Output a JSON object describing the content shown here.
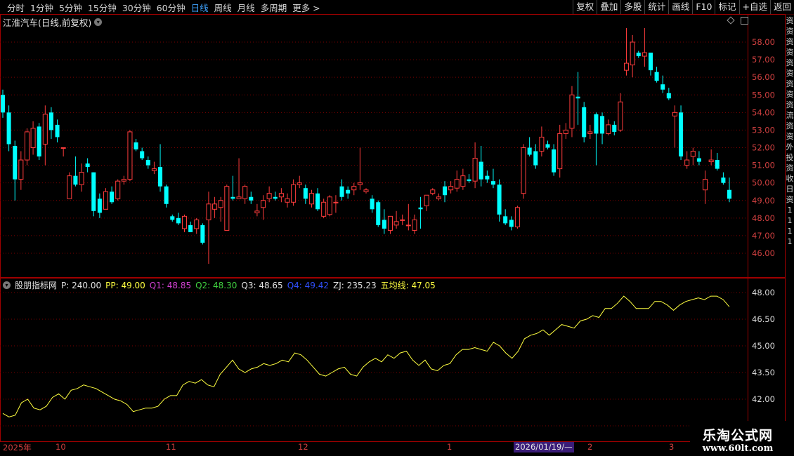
{
  "toolbar": {
    "left": [
      {
        "label": "分时",
        "active": false
      },
      {
        "label": "1分钟",
        "active": false
      },
      {
        "label": "5分钟",
        "active": false
      },
      {
        "label": "15分钟",
        "active": false
      },
      {
        "label": "30分钟",
        "active": false
      },
      {
        "label": "60分钟",
        "active": false
      },
      {
        "label": "日线",
        "active": true
      },
      {
        "label": "周线",
        "active": false
      },
      {
        "label": "月线",
        "active": false
      },
      {
        "label": "多周期",
        "active": false
      },
      {
        "label": "更多 >",
        "active": false
      }
    ],
    "right": [
      "复权",
      "叠加",
      "多股",
      "统计",
      "画线",
      "F10",
      "标记",
      "+自选",
      "返回"
    ]
  },
  "stock": {
    "title": "江淮汽车(日线,前复权)"
  },
  "indicator": {
    "name": "股朋指标网",
    "items": [
      {
        "label": "P: 240.00",
        "color": "#e0e0e0"
      },
      {
        "label": "PP: 49.00",
        "color": "#ffff40"
      },
      {
        "label": "Q1: 48.85",
        "color": "#d040d0"
      },
      {
        "label": "Q2: 48.30",
        "color": "#40d040"
      },
      {
        "label": "Q3: 48.65",
        "color": "#e0e0e0"
      },
      {
        "label": "Q4: 49.42",
        "color": "#3050ff"
      },
      {
        "label": "ZJ: 235.23",
        "color": "#e0e0e0"
      },
      {
        "label": "五均线: 47.05",
        "color": "#ffff40"
      }
    ]
  },
  "price_axis": [
    "58.00",
    "57.00",
    "56.00",
    "55.00",
    "54.00",
    "53.00",
    "52.00",
    "51.00",
    "50.00",
    "49.00",
    "48.00",
    "47.00",
    "46.00"
  ],
  "indicator_axis": [
    "48.00",
    "46.50",
    "45.00",
    "43.50",
    "42.00"
  ],
  "date_axis": [
    "2025年",
    "10",
    "11",
    "12",
    "1",
    "2",
    "3"
  ],
  "date_cursor": "2026/01/19/—",
  "right_strip": [
    "资",
    "资",
    "资",
    "资",
    "资",
    "资",
    "资",
    "资",
    "资",
    "流",
    "资",
    "资",
    "外",
    "投",
    "资",
    "收",
    "日",
    "资",
    "1",
    "1",
    "1",
    "1"
  ],
  "watermark": {
    "title": "乐淘公式网",
    "url": "www.60lt.com"
  },
  "colors": {
    "up": "#ff3c3c",
    "down": "#00ffff",
    "ma": "#ffff40",
    "grid": "#7a0000",
    "axis": "#a00000"
  },
  "chart_data": {
    "type": "candlestick",
    "price_ylim": [
      45.5,
      58.5
    ],
    "indicator_ylim": [
      41.0,
      48.5
    ],
    "candles": [
      [
        55.0,
        55.3,
        53.7,
        54.0
      ],
      [
        54.0,
        54.4,
        51.8,
        52.2
      ],
      [
        52.1,
        52.4,
        49.0,
        50.2
      ],
      [
        50.2,
        51.8,
        49.6,
        51.3
      ],
      [
        51.3,
        53.1,
        51.0,
        52.9
      ],
      [
        52.0,
        53.5,
        51.6,
        53.1
      ],
      [
        53.2,
        53.4,
        51.3,
        51.5
      ],
      [
        52.2,
        54.4,
        51.0,
        53.9
      ],
      [
        54.0,
        54.3,
        52.5,
        53.0
      ],
      [
        53.3,
        53.6,
        52.3,
        52.6
      ],
      [
        52.0,
        52.0,
        51.5,
        52.0
      ],
      [
        49.1,
        50.6,
        49.1,
        50.4
      ],
      [
        50.4,
        51.5,
        49.8,
        49.9
      ],
      [
        49.9,
        51.1,
        49.5,
        50.6
      ],
      [
        51.1,
        51.4,
        50.6,
        50.9
      ],
      [
        50.6,
        50.6,
        48.1,
        48.4
      ],
      [
        49.1,
        49.4,
        48.0,
        48.3
      ],
      [
        48.5,
        49.7,
        48.5,
        49.5
      ],
      [
        49.5,
        49.8,
        48.8,
        48.9
      ],
      [
        49.1,
        50.2,
        49.0,
        50.1
      ],
      [
        50.1,
        50.4,
        49.9,
        50.2
      ],
      [
        50.2,
        53.0,
        50.1,
        52.9
      ],
      [
        52.3,
        52.5,
        51.8,
        51.9
      ],
      [
        51.8,
        52.0,
        51.3,
        51.4
      ],
      [
        51.3,
        51.5,
        50.8,
        51.0
      ],
      [
        50.7,
        51.2,
        50.5,
        50.8
      ],
      [
        50.9,
        52.2,
        49.5,
        49.8
      ],
      [
        49.8,
        49.9,
        48.6,
        48.8
      ],
      [
        48.1,
        48.2,
        47.8,
        47.9
      ],
      [
        48.0,
        48.3,
        47.6,
        47.7
      ],
      [
        47.4,
        48.2,
        47.2,
        48.1
      ],
      [
        47.6,
        47.8,
        47.2,
        47.2
      ],
      [
        47.4,
        48.0,
        47.1,
        47.9
      ],
      [
        47.6,
        47.7,
        46.5,
        46.6
      ],
      [
        47.9,
        49.5,
        45.4,
        48.8
      ],
      [
        48.5,
        49.2,
        48.0,
        48.8
      ],
      [
        48.6,
        49.2,
        47.8,
        49.0
      ],
      [
        47.3,
        49.9,
        47.3,
        49.8
      ],
      [
        49.2,
        50.4,
        49.0,
        49.1
      ],
      [
        49.1,
        51.4,
        49.1,
        49.2
      ],
      [
        49.1,
        49.9,
        48.8,
        49.8
      ],
      [
        49.2,
        49.5,
        48.8,
        49.0
      ],
      [
        48.3,
        48.8,
        48.1,
        48.4
      ],
      [
        48.6,
        49.3,
        47.9,
        49.0
      ],
      [
        49.1,
        49.8,
        48.9,
        49.4
      ],
      [
        49.2,
        49.5,
        49.0,
        49.1
      ],
      [
        49.2,
        49.7,
        48.9,
        49.4
      ],
      [
        48.9,
        49.4,
        48.6,
        49.1
      ],
      [
        48.9,
        50.2,
        48.7,
        49.9
      ],
      [
        49.9,
        50.4,
        49.7,
        50.0
      ],
      [
        49.7,
        49.9,
        48.8,
        49.1
      ],
      [
        48.8,
        49.6,
        48.6,
        49.4
      ],
      [
        49.4,
        49.7,
        48.4,
        48.5
      ],
      [
        48.1,
        49.1,
        48.0,
        48.9
      ],
      [
        48.2,
        49.3,
        48.1,
        49.2
      ],
      [
        48.9,
        49.3,
        48.3,
        48.9
      ],
      [
        49.8,
        50.2,
        49.0,
        49.2
      ],
      [
        49.6,
        49.8,
        49.1,
        49.4
      ],
      [
        49.6,
        50.0,
        49.3,
        49.8
      ],
      [
        49.9,
        52.0,
        49.6,
        50.0
      ],
      [
        49.5,
        49.7,
        49.4,
        49.6
      ],
      [
        49.1,
        49.3,
        48.3,
        48.5
      ],
      [
        48.9,
        49.0,
        47.5,
        47.6
      ],
      [
        47.9,
        48.5,
        47.1,
        47.4
      ],
      [
        47.3,
        48.1,
        47.1,
        48.1
      ],
      [
        47.6,
        48.4,
        47.4,
        47.8
      ],
      [
        47.9,
        48.2,
        47.6,
        47.9
      ],
      [
        47.6,
        48.8,
        47.3,
        47.6
      ],
      [
        47.3,
        48.2,
        47.1,
        47.9
      ],
      [
        48.6,
        49.2,
        47.4,
        48.5
      ],
      [
        48.7,
        49.3,
        48.4,
        49.3
      ],
      [
        49.4,
        49.7,
        49.3,
        49.6
      ],
      [
        49.1,
        49.4,
        49.0,
        49.2
      ],
      [
        49.8,
        50.1,
        48.9,
        49.3
      ],
      [
        49.6,
        50.1,
        49.4,
        49.8
      ],
      [
        49.7,
        50.7,
        49.5,
        50.2
      ],
      [
        49.8,
        50.8,
        49.6,
        50.4
      ],
      [
        50.2,
        50.5,
        50.0,
        50.1
      ],
      [
        50.1,
        52.3,
        49.7,
        51.4
      ],
      [
        51.2,
        52.1,
        49.8,
        50.2
      ],
      [
        50.4,
        50.7,
        50.0,
        50.2
      ],
      [
        50.1,
        50.8,
        49.7,
        49.9
      ],
      [
        49.9,
        50.2,
        47.8,
        48.2
      ],
      [
        48.1,
        48.5,
        47.6,
        47.7
      ],
      [
        47.9,
        48.1,
        47.3,
        47.5
      ],
      [
        47.5,
        48.7,
        47.4,
        48.6
      ],
      [
        49.4,
        52.2,
        49.1,
        52.0
      ],
      [
        52.0,
        52.6,
        51.5,
        51.6
      ],
      [
        51.8,
        52.2,
        50.8,
        51.0
      ],
      [
        51.8,
        53.2,
        51.5,
        52.6
      ],
      [
        52.2,
        52.4,
        51.9,
        52.0
      ],
      [
        51.9,
        52.2,
        50.4,
        50.6
      ],
      [
        50.8,
        53.3,
        50.3,
        52.8
      ],
      [
        52.8,
        53.4,
        52.5,
        53.0
      ],
      [
        53.1,
        55.5,
        52.6,
        55.0
      ],
      [
        54.9,
        56.3,
        53.3,
        54.8
      ],
      [
        54.3,
        54.6,
        52.3,
        52.6
      ],
      [
        52.8,
        53.3,
        52.5,
        52.9
      ],
      [
        53.9,
        54.0,
        51.0,
        52.8
      ],
      [
        53.8,
        54.0,
        52.2,
        52.8
      ],
      [
        52.8,
        53.6,
        52.7,
        53.3
      ],
      [
        53.3,
        53.5,
        52.7,
        52.9
      ],
      [
        53.0,
        55.1,
        52.9,
        54.6
      ],
      [
        56.4,
        58.8,
        56.1,
        56.8
      ],
      [
        56.7,
        58.4,
        56.0,
        58.0
      ],
      [
        57.4,
        57.5,
        57.1,
        57.2
      ],
      [
        57.2,
        58.8,
        56.6,
        57.4
      ],
      [
        57.4,
        57.4,
        56.1,
        56.4
      ],
      [
        56.3,
        56.6,
        55.7,
        55.8
      ],
      [
        55.6,
        56.1,
        55.1,
        55.3
      ],
      [
        55.1,
        55.4,
        54.7,
        54.8
      ],
      [
        53.8,
        54.4,
        52.0,
        54.0
      ],
      [
        54.0,
        54.4,
        51.3,
        51.5
      ],
      [
        51.0,
        51.8,
        50.8,
        51.3
      ],
      [
        51.5,
        52.0,
        51.0,
        51.8
      ],
      [
        51.4,
        51.8,
        51.0,
        51.2
      ],
      [
        49.6,
        50.7,
        48.8,
        50.2
      ],
      [
        51.2,
        51.9,
        51.0,
        51.3
      ],
      [
        51.3,
        51.7,
        50.7,
        50.8
      ],
      [
        50.3,
        50.6,
        49.9,
        50.0
      ],
      [
        49.6,
        50.3,
        48.9,
        49.1
      ]
    ],
    "indicator_line": [
      41.2,
      41.0,
      41.1,
      41.8,
      42.0,
      41.5,
      41.4,
      41.6,
      42.1,
      42.3,
      42.0,
      42.5,
      42.6,
      42.8,
      42.7,
      42.6,
      42.4,
      42.2,
      42.0,
      41.9,
      41.7,
      41.3,
      41.4,
      41.5,
      41.5,
      41.6,
      42.0,
      42.2,
      42.2,
      42.8,
      43.0,
      42.9,
      43.1,
      42.8,
      42.7,
      43.4,
      43.8,
      44.2,
      43.7,
      43.5,
      43.7,
      43.8,
      44.0,
      43.9,
      44.0,
      44.2,
      44.1,
      44.6,
      44.5,
      44.2,
      43.8,
      43.4,
      43.3,
      43.5,
      43.7,
      43.8,
      43.4,
      43.3,
      43.8,
      44.1,
      44.3,
      44.1,
      44.5,
      44.3,
      44.6,
      44.7,
      44.2,
      43.9,
      44.2,
      43.7,
      43.6,
      43.9,
      44.0,
      44.5,
      44.8,
      44.8,
      44.9,
      44.8,
      44.7,
      45.2,
      45.0,
      44.6,
      44.3,
      44.7,
      45.4,
      45.6,
      45.7,
      45.9,
      45.6,
      45.9,
      46.2,
      46.1,
      46.0,
      46.4,
      46.5,
      46.7,
      46.6,
      47.1,
      47.1,
      47.4,
      47.8,
      47.5,
      47.1,
      47.1,
      47.1,
      47.5,
      47.5,
      47.3,
      47.0,
      47.3,
      47.5,
      47.6,
      47.7,
      47.6,
      47.8,
      47.8,
      47.6,
      47.2
    ]
  }
}
